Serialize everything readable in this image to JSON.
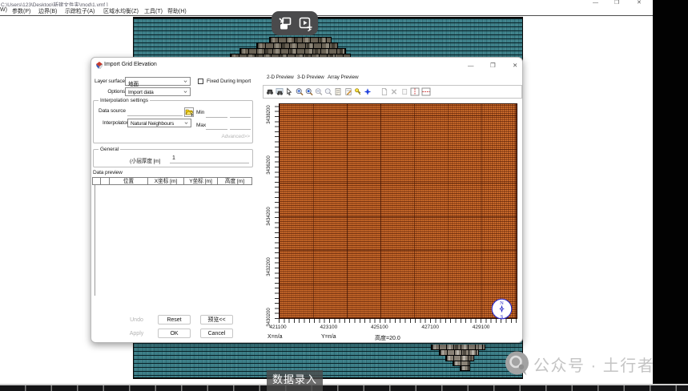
{
  "window": {
    "title": "C:\\Users\\123\\Desktop\\新建文件夹\\mod\\1.vmf ]",
    "controls": {
      "minimize": "—",
      "maximize": "❐",
      "close": "✕"
    },
    "menu": [
      "W)",
      "参数(P)",
      "边界(B)",
      "示踪粒子(A)",
      "区域水均衡(Z)",
      "工具(T)",
      "帮助(H)"
    ]
  },
  "recorder": {
    "icons": [
      "shrink-window-icon",
      "record-play-icon"
    ]
  },
  "dialog": {
    "title": "Import Grid Elevation",
    "controls": {
      "minimize": "—",
      "maximize": "❐",
      "close": "✕"
    },
    "fields": {
      "layer_surface_label": "Layer surface",
      "layer_surface_value": "地面",
      "fixed_checkbox_label": "Fixed During Import",
      "options_label": "Options",
      "options_value": "Import data",
      "interp_group_label": "Interpolation settings",
      "data_source_label": "Data source",
      "data_source_value": "",
      "min_label": "Min",
      "min_value": "",
      "interpolator_label": "Interpolator",
      "interpolator_value": "Natural Neighbours",
      "max_label": "Max",
      "max_value": "",
      "advanced_label": "Advanced>>",
      "general_group_label": "General",
      "thickness_label": "(小层厚度 [m]",
      "thickness_value": "1",
      "data_preview_label": "Data preview"
    },
    "table": {
      "headers": [
        "",
        "",
        "位置",
        "X坐标 [m]",
        "Y坐标 [m]",
        "高度 [m]"
      ],
      "rows": []
    },
    "buttons": {
      "undo": "Undo",
      "reset": "Reset",
      "preview": "预览<<",
      "apply": "Apply",
      "ok": "OK",
      "cancel": "Cancel"
    },
    "tabs": [
      "2-D Preview",
      "3-D Preview",
      "Array Preview"
    ],
    "toolbar_icons": [
      "binoculars-icon",
      "binoculars-export-icon",
      "cursor-icon",
      "zoom-in-icon",
      "zoom-original-icon",
      "zoom-out-icon",
      "zoom-window-icon",
      "report-icon",
      "edit-sheet-icon",
      "key-icon",
      "star-icon",
      "new-page-icon",
      "delete-icon",
      "blank-page-icon",
      "column-line-icon",
      "row-line-icon"
    ],
    "preview": {
      "y_ticks": [
        "3438200",
        "3436200",
        "3434200",
        "3432200",
        "3430200"
      ],
      "x_ticks": [
        "421100",
        "423100",
        "425100",
        "427100",
        "429100"
      ],
      "status_x": "X=n/a",
      "status_y": "Y=n/a",
      "status_elev": "高度=20.0",
      "compass_north": "N",
      "compass_south": "S"
    }
  },
  "caption": {
    "text": "数据录入"
  },
  "watermark": {
    "text": "公众号 · 土行者"
  },
  "colors": {
    "model_teal": "#3d7f88",
    "plot_orange": "#e2701e",
    "recorder_gray": "#4a4a4c",
    "compass_blue": "#2a2ac8"
  }
}
